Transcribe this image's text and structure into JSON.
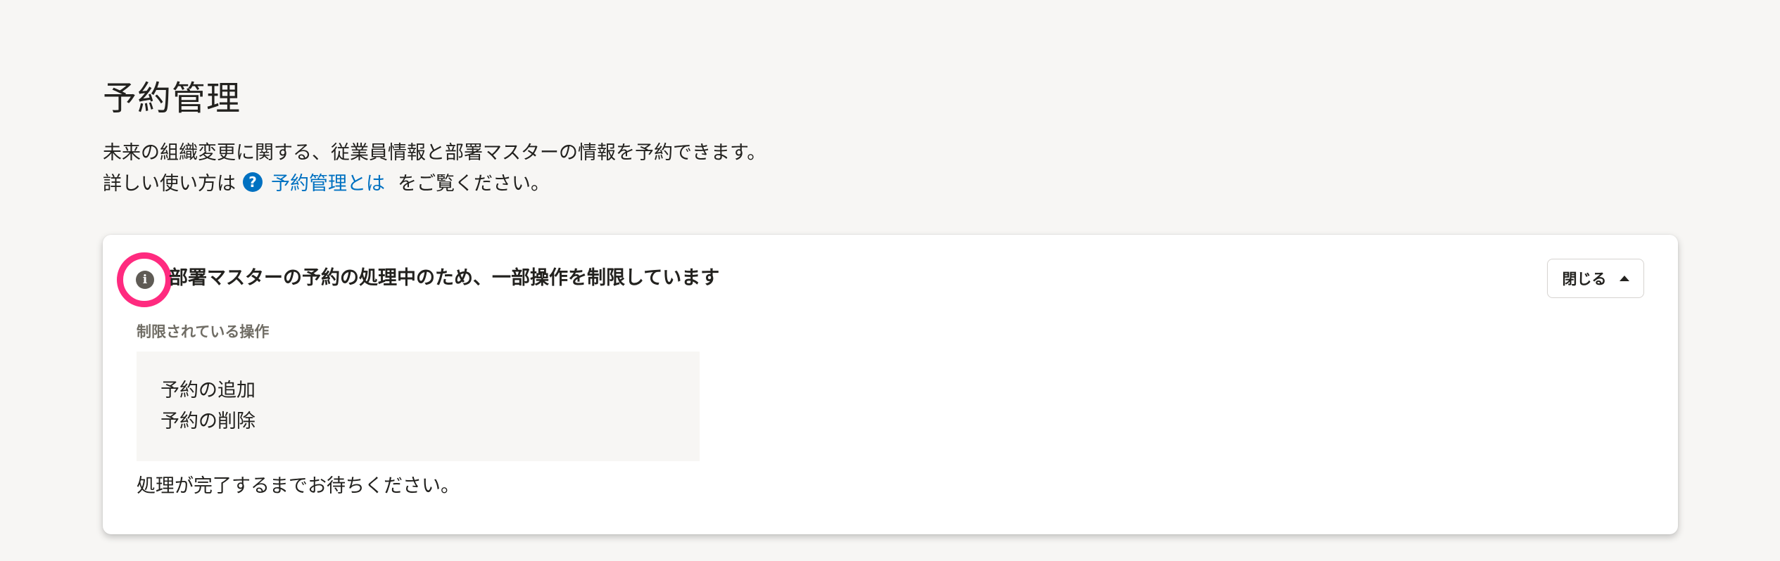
{
  "page": {
    "title": "予約管理",
    "description_line1": "未来の組織変更に関する、従業員情報と部署マスターの情報を予約できます。",
    "description_line2_prefix": "詳しい使い方は",
    "help_icon": "question-circle-icon",
    "help_link_label": "予約管理とは",
    "description_line2_suffix": "をご覧ください。",
    "help_icon_glyph": "?"
  },
  "alert": {
    "icon": "info-circle-icon",
    "icon_glyph": "i",
    "highlight_color": "#ff2a7f",
    "title": "部署マスターの予約の処理中のため、一部操作を制限しています",
    "close_button_label": "閉じる",
    "restricted_label": "制限されている操作",
    "restricted_operations": [
      "予約の追加",
      "予約の削除"
    ],
    "footer": "処理が完了するまでお待ちください。"
  },
  "colors": {
    "background": "#f7f6f4",
    "link": "#0071c1",
    "text": "#23221f"
  }
}
